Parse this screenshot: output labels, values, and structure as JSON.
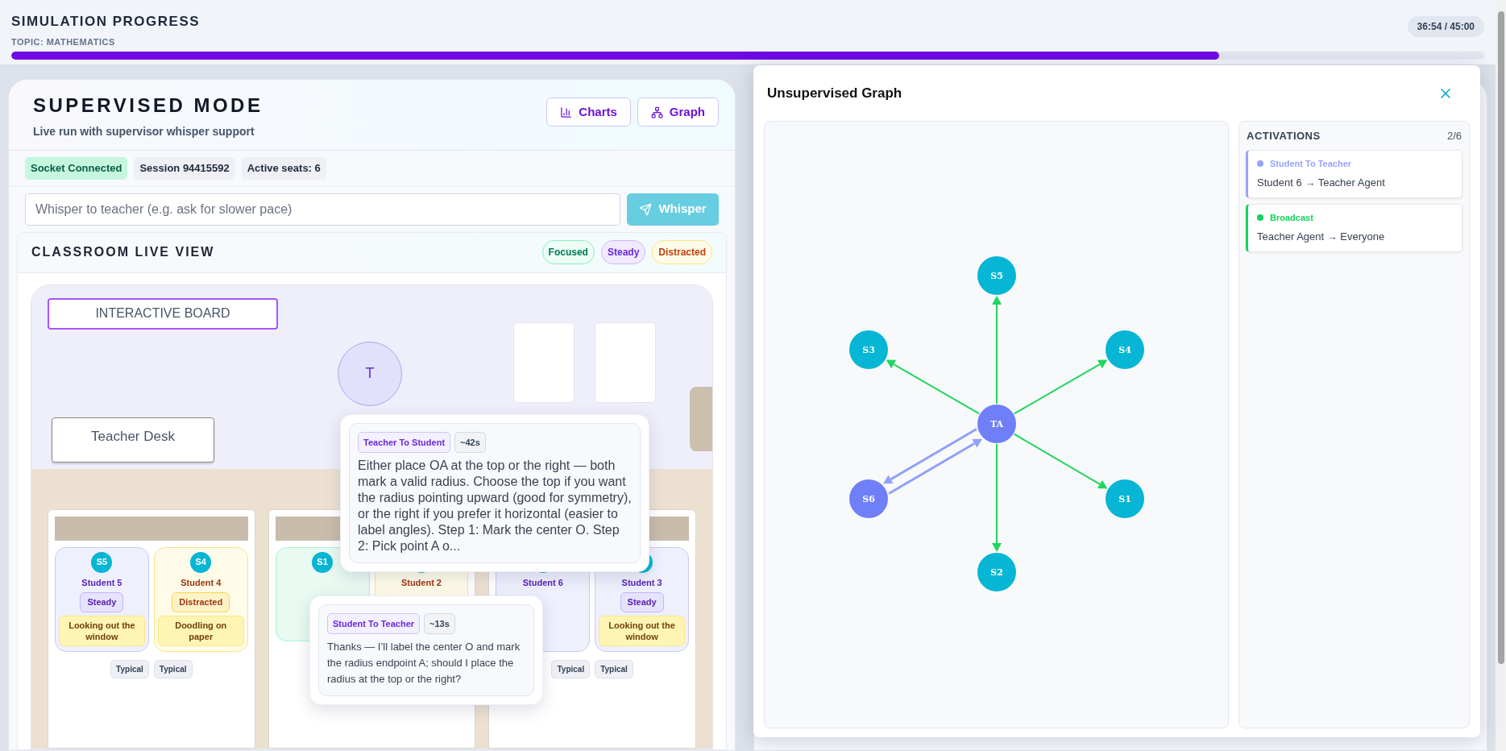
{
  "progress": {
    "title": "SIMULATION PROGRESS",
    "topic": "TOPIC: MATHEMATICS",
    "time": "36:54 / 45:00",
    "level": 0.82
  },
  "panel": {
    "title": "SUPERVISED MODE",
    "subtitle": "Live run with supervisor whisper support",
    "buttons": [
      {
        "label": "Charts",
        "kind": "charts"
      },
      {
        "label": "Graph",
        "kind": "graph"
      }
    ],
    "badges": [
      {
        "label": "Socket Connected",
        "kind": "success"
      },
      {
        "label": "Session 94415592",
        "kind": "neutral"
      },
      {
        "label": "Active seats: 6",
        "kind": "neutral"
      }
    ],
    "whisper": {
      "placeholder": "Whisper to teacher (e.g. ask for slower pace)",
      "button": "Whisper"
    }
  },
  "classroom": {
    "title": "CLASSROOM LIVE VIEW",
    "legend": [
      {
        "label": "Focused",
        "kind": "focused"
      },
      {
        "label": "Steady",
        "kind": "steady"
      },
      {
        "label": "Distracted",
        "kind": "distracted"
      }
    ],
    "board": "INTERACTIVE BOARD",
    "teacher": "T",
    "desk": "Teacher Desk",
    "groups": [
      {
        "students": [
          {
            "avatar": "S5",
            "name": "Student 5",
            "kind": "steady",
            "status": "Steady",
            "activity": "Looking out the window"
          },
          {
            "avatar": "S4",
            "name": "Student 4",
            "kind": "distracted",
            "status": "Distracted",
            "activity": "Doodling on paper"
          }
        ],
        "tags": [
          "Typical",
          "Typical"
        ]
      },
      {
        "students": [
          {
            "avatar": "S1",
            "kind": "focused"
          },
          {
            "name": "Student 2",
            "kind": "distracted"
          }
        ]
      },
      {
        "students": [
          {
            "name": "Student 6",
            "kind": "steady"
          },
          {
            "name": "Student 3",
            "kind": "steady",
            "status": "Steady",
            "activity": "Looking out the window"
          }
        ],
        "tags": [
          "Typical",
          "Typical"
        ]
      }
    ],
    "bubbles": [
      {
        "kind": "teacher",
        "label": "Teacher To Student",
        "time": "~42s",
        "text": "Either place OA at the top or the right — both mark a valid radius. Choose the top if you want the radius pointing upward (good for symmetry), or the right if you prefer it horizontal (easier to label angles). Step 1: Mark the center O. Step 2: Pick point A o..."
      },
      {
        "kind": "student",
        "label": "Student To Teacher",
        "time": "~13s",
        "text": "Thanks — I’ll label the center O and mark the radius endpoint A; should I place the radius at the top or the right?"
      }
    ]
  },
  "modal": {
    "title": "Unsupervised Graph",
    "graph": {
      "nodes": [
        {
          "label": "S5",
          "kind": "broadcast",
          "color": "#06b6d4"
        },
        {
          "label": "S3",
          "kind": "broadcast",
          "color": "#06b6d4"
        },
        {
          "label": "S4",
          "kind": "broadcast",
          "color": "#06b6d4"
        },
        {
          "label": "TA",
          "kind": "center",
          "color": "#6f7ff7"
        },
        {
          "label": "S6",
          "kind": "exchange",
          "color": "#6f7ff7"
        },
        {
          "label": "S1",
          "kind": "broadcast",
          "color": "#06b6d4"
        },
        {
          "label": "S2",
          "kind": "broadcast",
          "color": "#06b6d4"
        }
      ]
    },
    "activations": {
      "title": "ACTIVATIONS",
      "count": "2/6",
      "items": [
        {
          "label": "Student To Teacher",
          "route": "Student 6 → Teacher Agent",
          "color": "#96a5f9"
        },
        {
          "label": "Broadcast",
          "route": "Teacher Agent → Everyone",
          "color": "#12d35a"
        }
      ]
    }
  }
}
